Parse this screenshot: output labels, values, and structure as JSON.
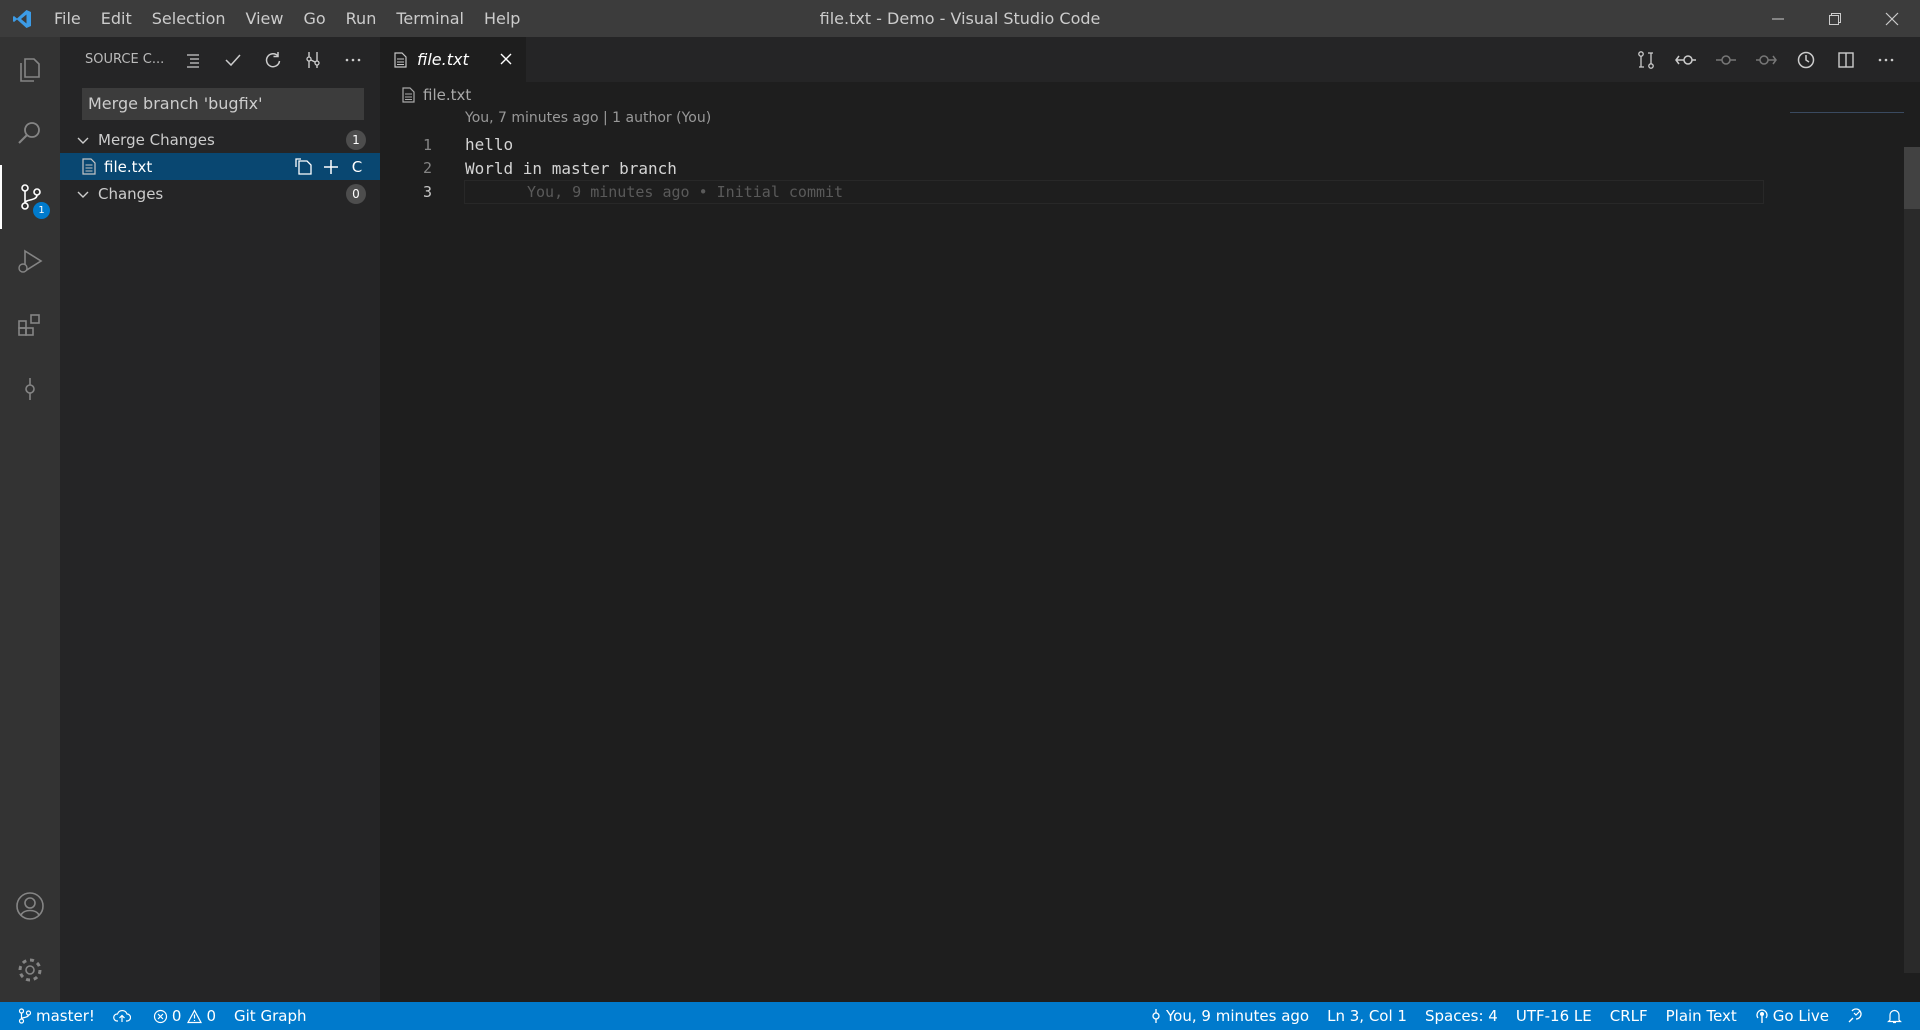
{
  "titlebar": {
    "menu": [
      "File",
      "Edit",
      "Selection",
      "View",
      "Go",
      "Run",
      "Terminal",
      "Help"
    ],
    "window_title": "file.txt - Demo - Visual Studio Code"
  },
  "activitybar": {
    "scm_badge": "1"
  },
  "sidebar": {
    "title": "SOURCE C...",
    "commit_message": "Merge branch 'bugfix'",
    "merge_group": {
      "label": "Merge Changes",
      "count": "1"
    },
    "merge_file": {
      "name": "file.txt",
      "status": "C"
    },
    "changes_group": {
      "label": "Changes",
      "count": "0"
    }
  },
  "editor": {
    "tab_label": "file.txt",
    "breadcrumb": "file.txt",
    "codelens": "You, 7 minutes ago | 1 author (You)",
    "lines": [
      {
        "num": "1",
        "text": "hello"
      },
      {
        "num": "2",
        "text": "World in master branch"
      },
      {
        "num": "3",
        "text": ""
      }
    ],
    "blame": "You, 9 minutes ago • Initial commit"
  },
  "statusbar": {
    "branch": "master!",
    "errors": "0",
    "warnings": "0",
    "git_graph": "Git Graph",
    "blame": "You, 9 minutes ago",
    "position": "Ln 3, Col 1",
    "spaces": "Spaces: 4",
    "encoding": "UTF-16 LE",
    "eol": "CRLF",
    "language": "Plain Text",
    "go_live": "Go Live"
  },
  "colors": {
    "accent": "#007acc",
    "selection": "#094771",
    "titlebar": "#3c3c3c",
    "sidebar": "#252526",
    "editor": "#1e1e1e"
  }
}
